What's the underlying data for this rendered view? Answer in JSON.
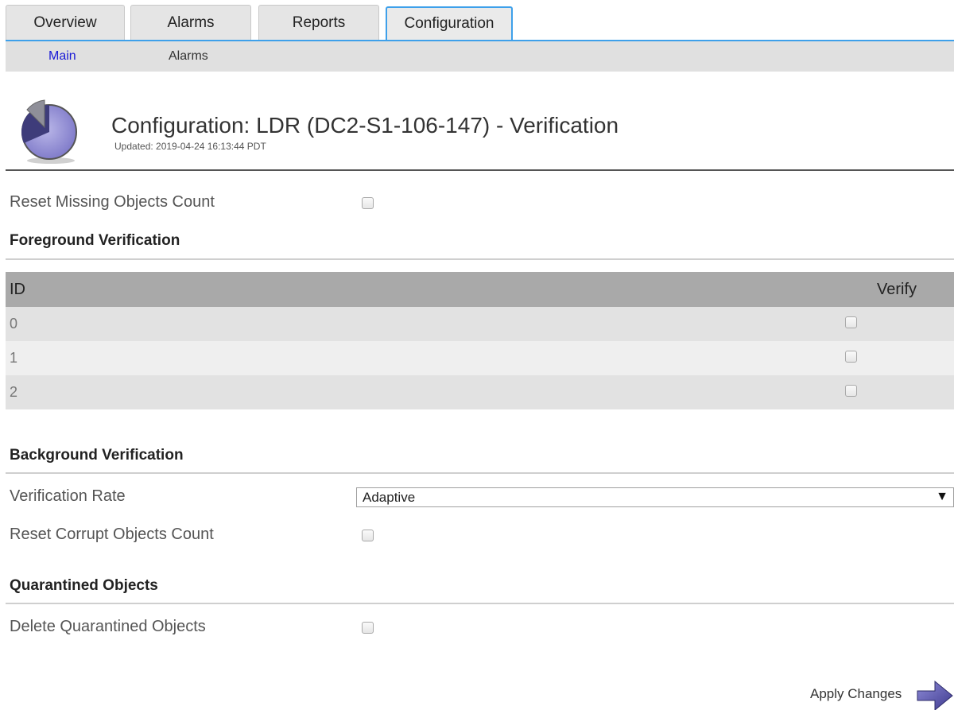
{
  "tabs": [
    {
      "label": "Overview",
      "active": false
    },
    {
      "label": "Alarms",
      "active": false
    },
    {
      "label": "Reports",
      "active": false
    },
    {
      "label": "Configuration",
      "active": true
    }
  ],
  "subtabs": [
    {
      "label": "Main",
      "active": true
    },
    {
      "label": "Alarms",
      "active": false
    }
  ],
  "header": {
    "title": "Configuration: LDR (DC2-S1-106-147) - Verification",
    "updated": "Updated: 2019-04-24 16:13:44 PDT",
    "icon": "pie-chart-icon"
  },
  "reset_missing": {
    "label": "Reset Missing Objects Count",
    "checked": false
  },
  "foreground": {
    "title": "Foreground Verification",
    "columns": [
      "ID",
      "Verify"
    ],
    "rows": [
      {
        "id": "0",
        "verify": false
      },
      {
        "id": "1",
        "verify": false
      },
      {
        "id": "2",
        "verify": false
      }
    ]
  },
  "background": {
    "title": "Background Verification",
    "rate_label": "Verification Rate",
    "rate_value": "Adaptive",
    "reset_corrupt": {
      "label": "Reset Corrupt Objects Count",
      "checked": false
    }
  },
  "quarantine": {
    "title": "Quarantined Objects",
    "delete": {
      "label": "Delete Quarantined Objects",
      "checked": false
    }
  },
  "apply": {
    "label": "Apply Changes",
    "icon": "arrow-right-icon"
  },
  "colors": {
    "accent": "#3ea0ea",
    "link_active": "#1a1ad6",
    "table_header": "#a9a9a9"
  }
}
